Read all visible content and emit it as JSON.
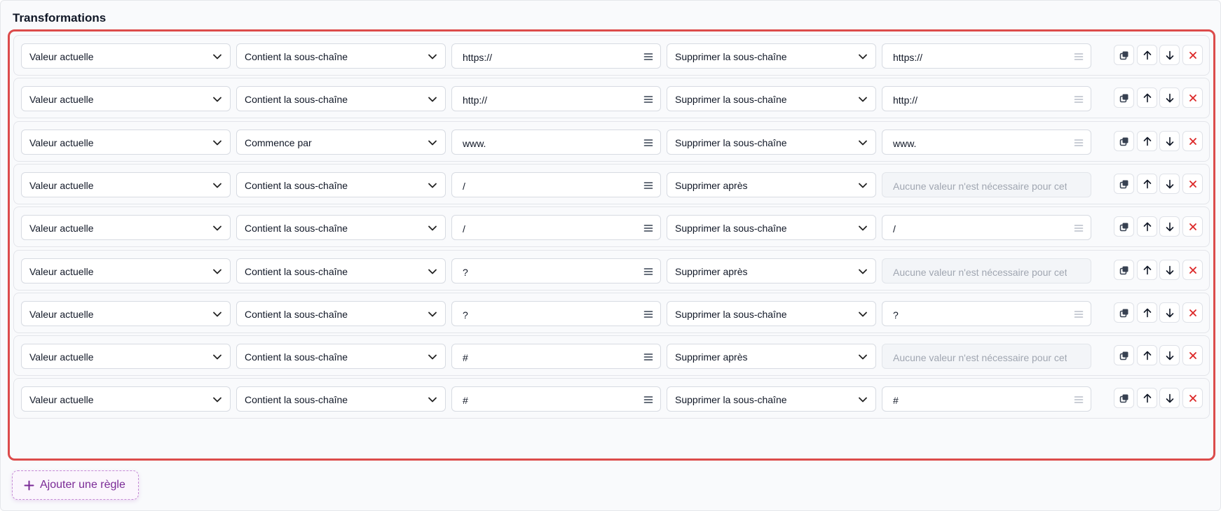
{
  "section": {
    "title": "Transformations"
  },
  "rules": [
    {
      "source": "Valeur actuelle",
      "condition": "Contient la sous-chaîne",
      "match": "https://",
      "action": "Supprimer la sous-chaîne",
      "value": "https://",
      "value_disabled": false
    },
    {
      "source": "Valeur actuelle",
      "condition": "Contient la sous-chaîne",
      "match": "http://",
      "action": "Supprimer la sous-chaîne",
      "value": "http://",
      "value_disabled": false
    },
    {
      "source": "Valeur actuelle",
      "condition": "Commence par",
      "match": "www.",
      "action": "Supprimer la sous-chaîne",
      "value": "www.",
      "value_disabled": false
    },
    {
      "source": "Valeur actuelle",
      "condition": "Contient la sous-chaîne",
      "match": "/",
      "action": "Supprimer après",
      "value": "Aucune valeur n'est nécessaire pour cet",
      "value_disabled": true
    },
    {
      "source": "Valeur actuelle",
      "condition": "Contient la sous-chaîne",
      "match": "/",
      "action": "Supprimer la sous-chaîne",
      "value": "/",
      "value_disabled": false
    },
    {
      "source": "Valeur actuelle",
      "condition": "Contient la sous-chaîne",
      "match": "?",
      "action": "Supprimer après",
      "value": "Aucune valeur n'est nécessaire pour cet",
      "value_disabled": true
    },
    {
      "source": "Valeur actuelle",
      "condition": "Contient la sous-chaîne",
      "match": "?",
      "action": "Supprimer la sous-chaîne",
      "value": "?",
      "value_disabled": false
    },
    {
      "source": "Valeur actuelle",
      "condition": "Contient la sous-chaîne",
      "match": "#",
      "action": "Supprimer après",
      "value": "Aucune valeur n'est nécessaire pour cet",
      "value_disabled": true
    },
    {
      "source": "Valeur actuelle",
      "condition": "Contient la sous-chaîne",
      "match": "#",
      "action": "Supprimer la sous-chaîne",
      "value": "#",
      "value_disabled": false
    }
  ],
  "icons": {
    "select": "chevron-down-icon",
    "input_menu": "menu-lines-icon",
    "duplicate": "duplicate-icon",
    "move_up": "arrow-up-icon",
    "move_down": "arrow-down-icon",
    "delete": "close-icon",
    "add": "plus-icon"
  },
  "actions": {
    "add_rule_label": "Ajouter une règle"
  },
  "colors": {
    "highlight_border": "#dc4b4b",
    "delete_icon": "#dc2626",
    "add_button_text": "#7a2a96",
    "add_button_border": "#c68ad6"
  }
}
